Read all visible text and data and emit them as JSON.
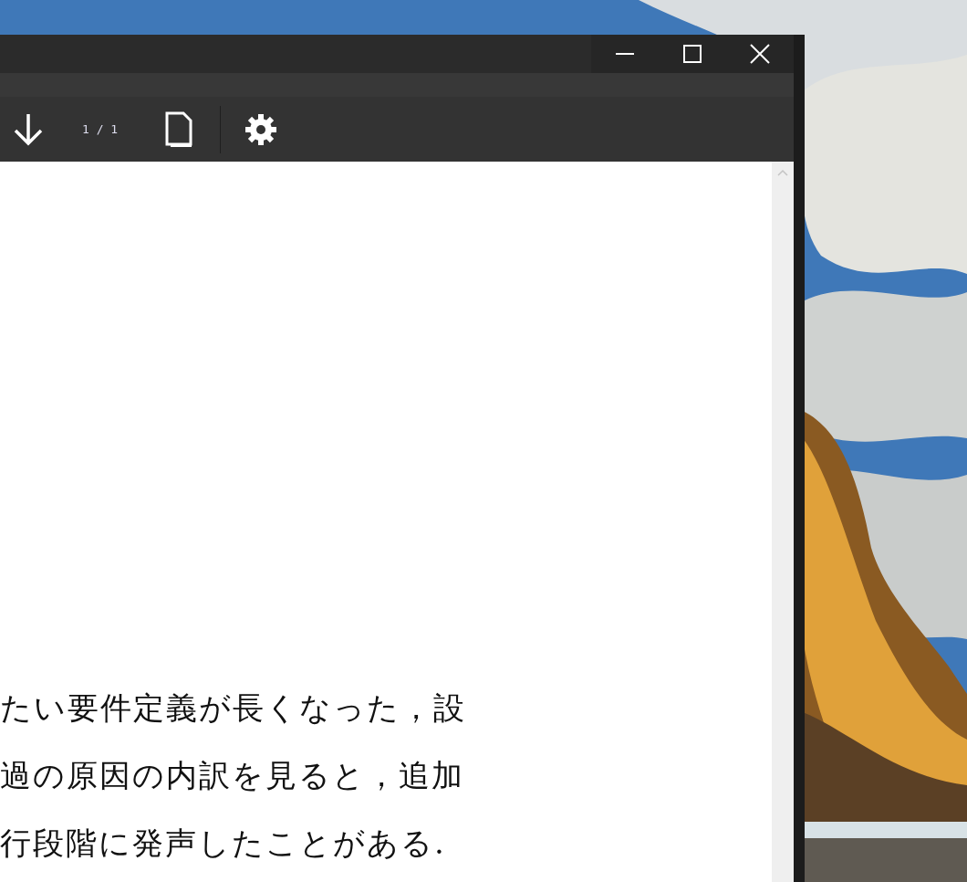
{
  "viewer": {
    "page_indicator": "1 / 1",
    "document_lines": [
      "たい要件定義が長くなった，設",
      "過の原因の内訳を見ると，追加",
      "行段階に発声したことがある."
    ]
  }
}
